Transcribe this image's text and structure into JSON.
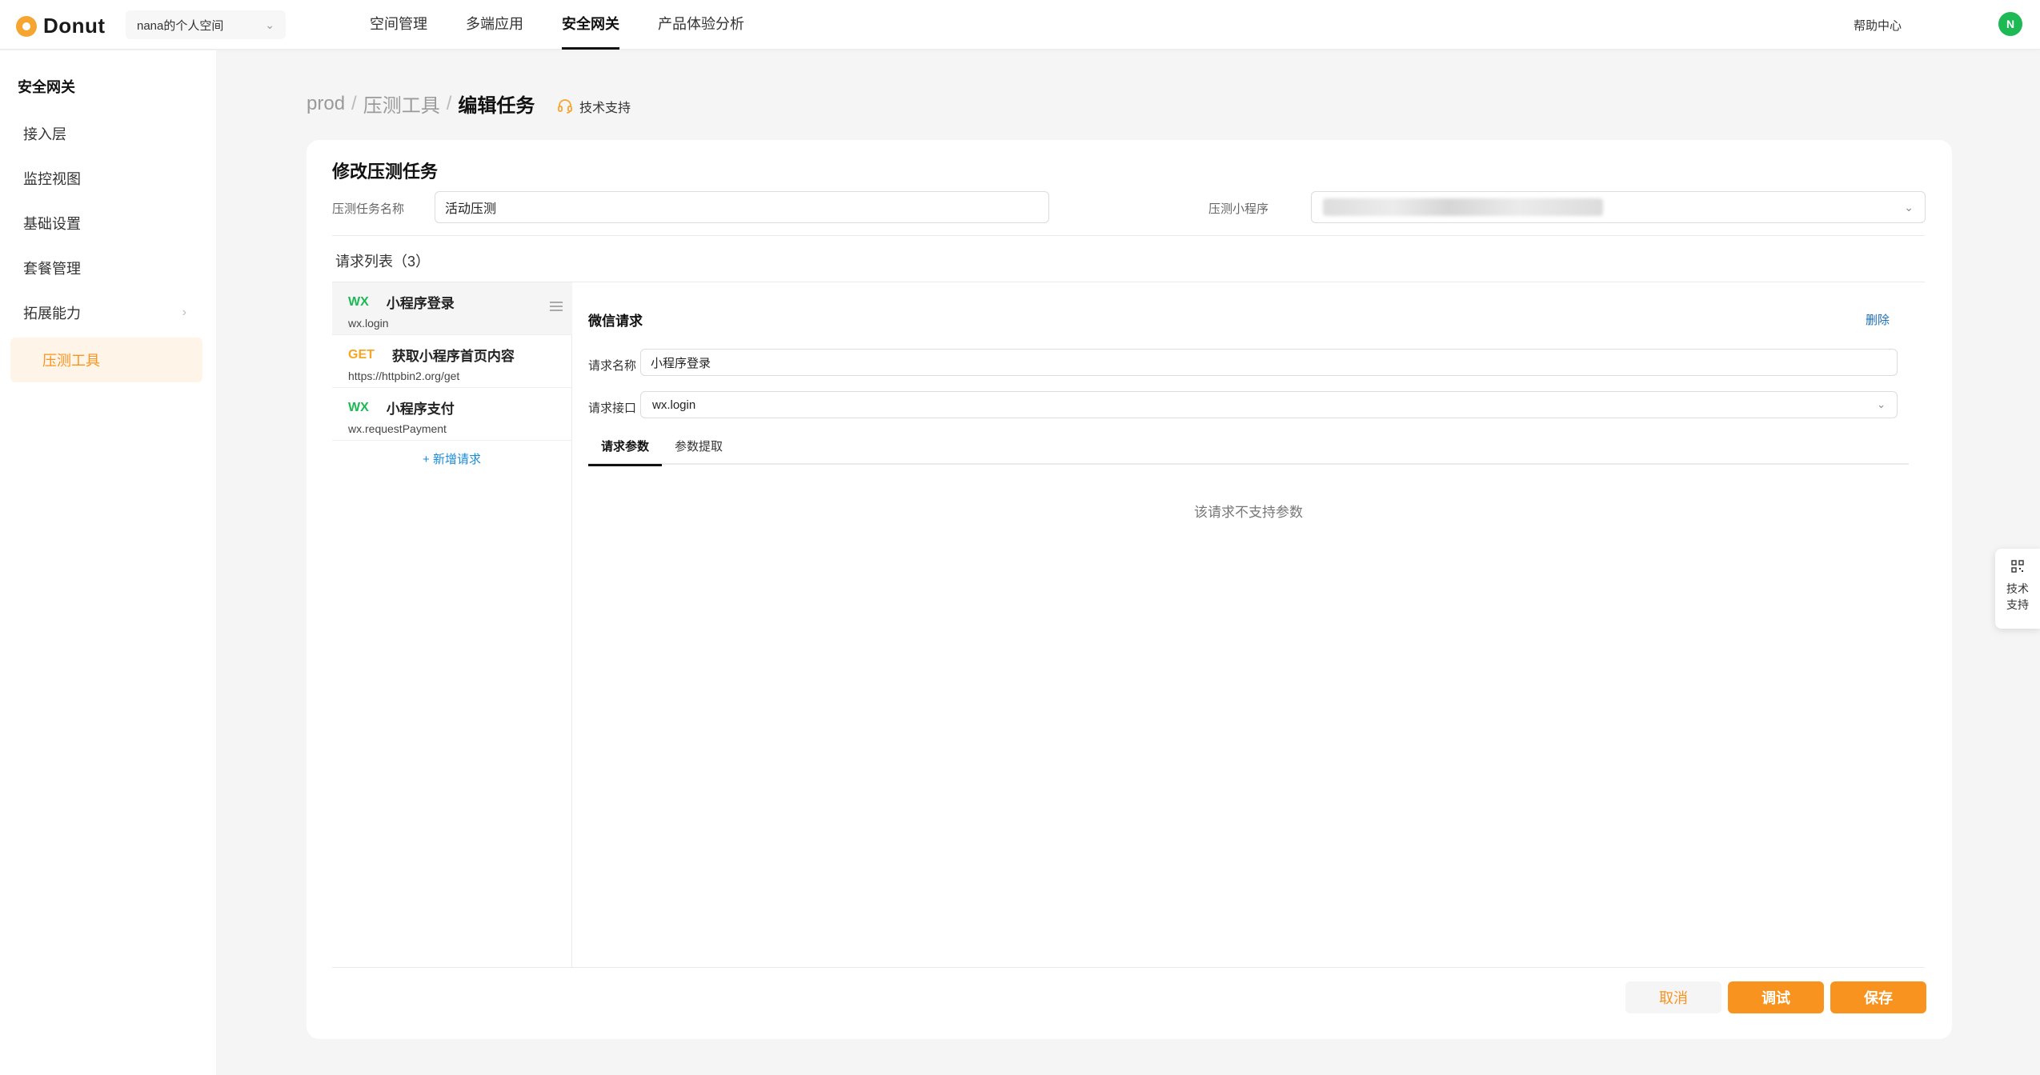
{
  "header": {
    "logo_text": "Donut",
    "workspace": "nana的个人空间",
    "nav": [
      "空间管理",
      "多端应用",
      "安全网关",
      "产品体验分析"
    ],
    "active_nav": "安全网关",
    "help": "帮助中心",
    "avatar_initial": "N"
  },
  "sidebar": {
    "title": "安全网关",
    "items": [
      "接入层",
      "监控视图",
      "基础设置",
      "套餐管理",
      "拓展能力",
      "压测工具"
    ],
    "active_item": "压测工具"
  },
  "breadcrumb": {
    "items": [
      "prod",
      "压测工具",
      "编辑任务"
    ],
    "support": "技术支持"
  },
  "form": {
    "title": "修改压测任务",
    "task_name_label": "压测任务名称",
    "task_name_value": "活动压测",
    "miniprogram_label": "压测小程序"
  },
  "request_list": {
    "heading": "请求列表（3）",
    "items": [
      {
        "method": "WX",
        "name": "小程序登录",
        "sub": "wx.login"
      },
      {
        "method": "GET",
        "name": "获取小程序首页内容",
        "sub": "https://httpbin2.org/get"
      },
      {
        "method": "WX",
        "name": "小程序支付",
        "sub": "wx.requestPayment"
      }
    ],
    "add_label": "+ 新增请求"
  },
  "detail": {
    "title": "微信请求",
    "delete": "删除",
    "name_label": "请求名称",
    "name_value": "小程序登录",
    "api_label": "请求接口",
    "api_value": "wx.login",
    "tabs": [
      "请求参数",
      "参数提取"
    ],
    "active_tab": "请求参数",
    "empty": "该请求不支持参数"
  },
  "footer": {
    "cancel": "取消",
    "debug": "调试",
    "save": "保存"
  },
  "float": {
    "line1": "技术",
    "line2": "支持"
  },
  "colors": {
    "accent": "#f7931e",
    "wx_green": "#1db954",
    "get_orange": "#f5a623",
    "link_blue": "#1a6fb8"
  }
}
